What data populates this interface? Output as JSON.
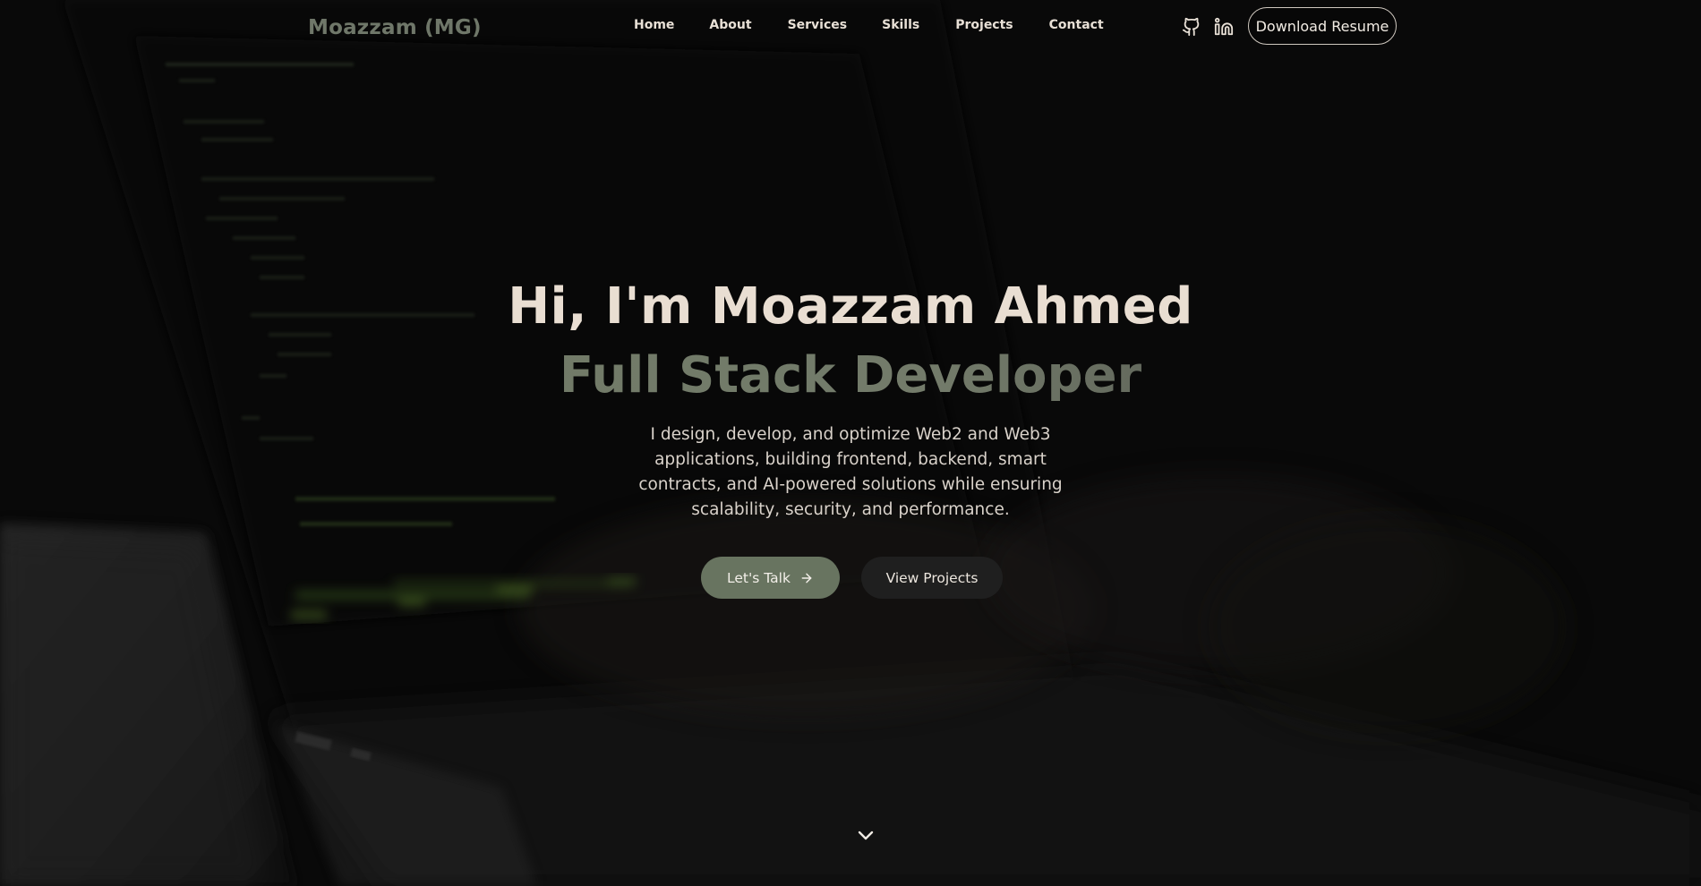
{
  "brand": {
    "name": "Moazzam (MG)"
  },
  "nav": {
    "links": [
      "Home",
      "About",
      "Services",
      "Skills",
      "Projects",
      "Contact"
    ],
    "icons": [
      "github-icon",
      "linkedin-icon"
    ],
    "resume_label": "Download Resume"
  },
  "hero": {
    "title": "Hi, I'm Moazzam Ahmed",
    "subtitle": "Full Stack Developer",
    "description": "I design, develop, and optimize Web2 and Web3 applications, building frontend, backend, smart contracts, and AI-powered solutions while ensuring scalability, security, and performance.",
    "primary_button": "Let's Talk",
    "secondary_button": "View Projects",
    "scroll_icon": "chevron-down-icon"
  },
  "colors": {
    "background": "#0b0b0b",
    "brand": "#6f7769",
    "title": "#e9ded2",
    "subtitle": "#6a7263",
    "accent_button": "#687460",
    "secondary_button": "#1f1f1f",
    "text": "#d9d2ca"
  }
}
